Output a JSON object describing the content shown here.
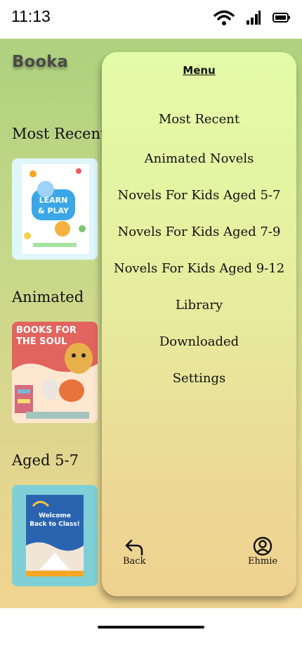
{
  "status": {
    "time": "11:13",
    "icons": [
      "wifi-icon",
      "cellular-signal-icon",
      "battery-icon"
    ]
  },
  "app": {
    "title": "Booka",
    "sections": [
      {
        "title": "Most Recent",
        "cover_title_line1": "LEARN",
        "cover_title_line2": "& PLAY"
      },
      {
        "title": "Animated",
        "cover_title_line1": "BOOKS FOR",
        "cover_title_line2": "THE SOUL"
      },
      {
        "title": "Aged 5-7",
        "cover_title_line1": "Welcome",
        "cover_title_line2": "Back to Class!"
      }
    ]
  },
  "menu": {
    "title": "Menu",
    "items": [
      "Most Recent",
      "Animated Novels",
      "Novels For Kids Aged 5-7",
      "Novels For Kids Aged 7-9",
      "Novels For Kids Aged 9-12",
      "Library",
      "Downloaded",
      "Settings"
    ],
    "back_label": "Back",
    "profile_label": "Ehmie"
  },
  "colors": {
    "background_top": "#aed27f",
    "background_bottom": "#f0d48f",
    "menu_top": "#e3fca8",
    "menu_bottom": "#efd28f"
  }
}
